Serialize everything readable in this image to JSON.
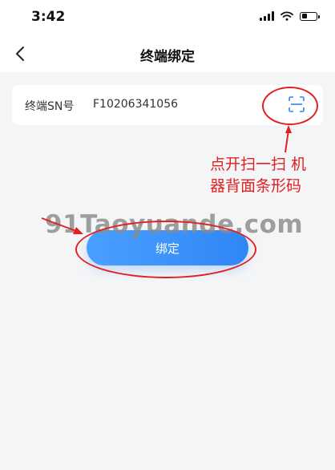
{
  "status_bar": {
    "time": "3:42"
  },
  "header": {
    "title": "终端绑定"
  },
  "form": {
    "sn_label": "终端SN号",
    "sn_value": "F10206341056"
  },
  "button": {
    "bind_label": "绑定"
  },
  "annotation": {
    "line1": "点开扫一扫 机",
    "line2": "器背面条形码"
  },
  "watermark": {
    "text": "91Taoyuande.com"
  },
  "colors": {
    "accent": "#2f86f6",
    "annotation": "#e32020",
    "background": "#f4f5f7"
  },
  "icons": [
    "signal-icon",
    "wifi-icon",
    "battery-icon",
    "back-arrow-icon",
    "scan-icon"
  ]
}
